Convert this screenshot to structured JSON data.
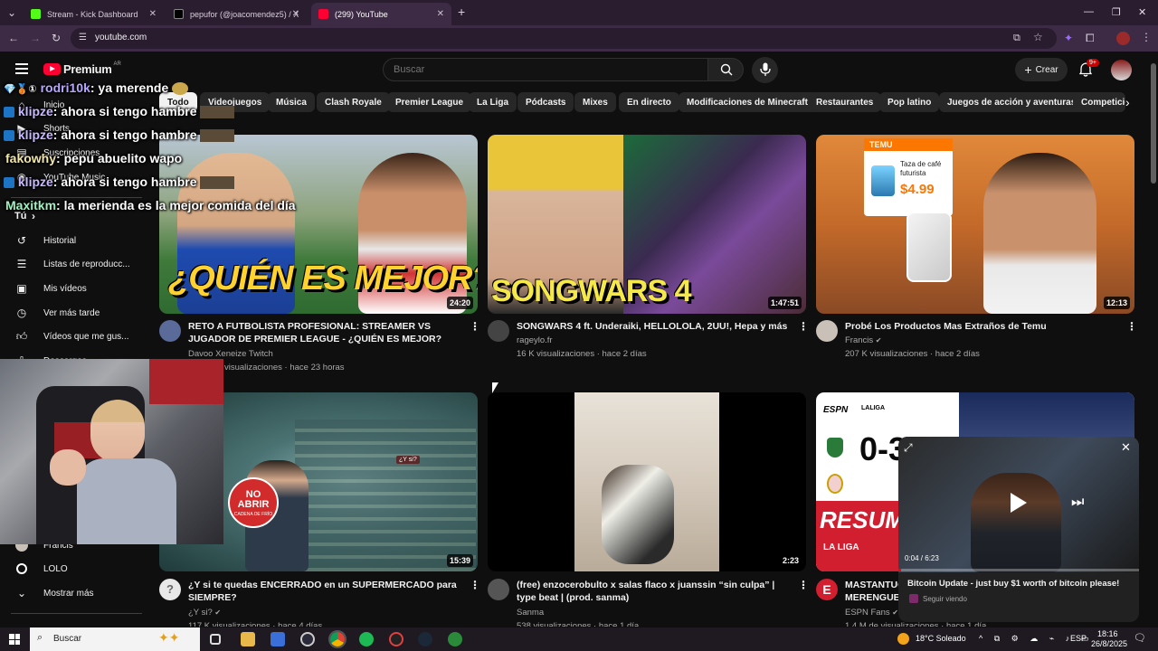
{
  "browser": {
    "tabs": [
      {
        "title": "Stream - Kick Dashboard",
        "color": "#53fc18"
      },
      {
        "title": "pepufor (@joacomendez5) / X",
        "color": "#000000"
      },
      {
        "title": "(299) YouTube",
        "color": "#ff0033"
      }
    ],
    "address": "youtube.com"
  },
  "youtube": {
    "logo_text": "Premium",
    "country_code": "AR",
    "search_placeholder": "Buscar",
    "create_label": "Crear",
    "notif_count": "9+",
    "chips": [
      "Todo",
      "Videojuegos",
      "Música",
      "Clash Royale",
      "Premier League",
      "La Liga",
      "Pódcasts",
      "Mixes",
      "En directo",
      "Modificaciones de Minecraft",
      "Restaurantes",
      "Pop latino",
      "Juegos de acción y aventuras",
      "Competicio"
    ],
    "sidebar": {
      "top": [
        "Inicio",
        "Shorts",
        "Suscripciones",
        "YouTube Music"
      ],
      "you_label": "Tú",
      "you_items": [
        "Historial",
        "Listas de reproducc...",
        "Mis vídeos",
        "Ver más tarde",
        "Vídeos que me gus...",
        "Descargas"
      ],
      "subs": [
        "Francis",
        "LOLO"
      ],
      "more": "Mostrar más"
    },
    "videos": [
      {
        "title": "RETO A FUTBOLISTA PROFESIONAL: STREAMER VS JUGADOR DE PREMIER LEAGUE - ¿QUIÉN ES MEJOR?",
        "channel": "Davoo Xeneize Twitch",
        "stats": "visualizaciones · hace 23 horas",
        "duration": "24:20",
        "thumb_text": "¿QUIÉN ES MEJOR?"
      },
      {
        "title": "SONGWARS 4 ft. Underaiki, HELLOLOLA, 2UU!, Hepa y más",
        "channel": "rageylo.fr",
        "stats": "16 K visualizaciones · hace 2 días",
        "duration": "1:47:51",
        "thumb_text": "SONGWARS 4"
      },
      {
        "title": "Probé Los Productos Mas Extraños de Temu",
        "channel": "Francis",
        "stats": "207 K visualizaciones · hace 2 días",
        "duration": "12:13",
        "thumb_brand": "TEMU",
        "thumb_caption": "Taza de café futurista",
        "thumb_price": "$4.99"
      },
      {
        "title": "¿Y si te quedas ENCERRADO en un SUPERMERCADO para SIEMPRE?",
        "channel": "¿Y si?",
        "stats": "117 K visualizaciones · hace 4 días",
        "duration": "15:39",
        "thumb_sign": "NO ABRIR",
        "thumb_sign_sub": "CADENA DE FRÍO",
        "thumb_tag": "¿Y si?"
      },
      {
        "title": "(free) enzocerobulto x salas flaco x juanssin “sin culpa” | type beat | (prod. sanma)",
        "channel": "Sanma",
        "stats": "538 visualizaciones · hace 1 día",
        "duration": "2:23"
      },
      {
        "title": "MASTANTUONO... MERENGUE",
        "channel": "ESPN Fans",
        "stats": "1,4 M de visualizaciones · hace 1 día",
        "duration": "",
        "thumb_score": "0-3",
        "thumb_resumen": "RESUMEN",
        "thumb_league": "LA LIGA",
        "thumb_espn": "ESPN",
        "thumb_laliga_logo": "LALIGA"
      }
    ],
    "miniplayer": {
      "time": "0:04 / 6:23",
      "title": "Bitcoin Update - just buy $1 worth of bitcoin please!",
      "status": "Seguir viendo",
      "progress": 0.01
    }
  },
  "chat": [
    {
      "user": "rodri10k",
      "message": ": ya merende",
      "color": "#b9a7ff"
    },
    {
      "user": "klipze",
      "message": ": ahora si tengo hambre",
      "color": "#c9b8ff"
    },
    {
      "user": "klipze",
      "message": ": ahora si tengo hambre",
      "color": "#c9b8ff"
    },
    {
      "user": "fakowhy",
      "message": ": pepu abuelito wapo",
      "color": "#f2e7a8"
    },
    {
      "user": "klipze",
      "message": ": ahora si tengo hambre",
      "color": "#c9b8ff"
    },
    {
      "user": "Maxitkm",
      "message": ": la merienda es la mejor comida del día",
      "color": "#9ff2c0"
    }
  ],
  "taskbar": {
    "search": "Buscar",
    "weather": "18°C  Soleado",
    "lang": "ESP",
    "time": "18:16",
    "date": "26/8/2025"
  }
}
